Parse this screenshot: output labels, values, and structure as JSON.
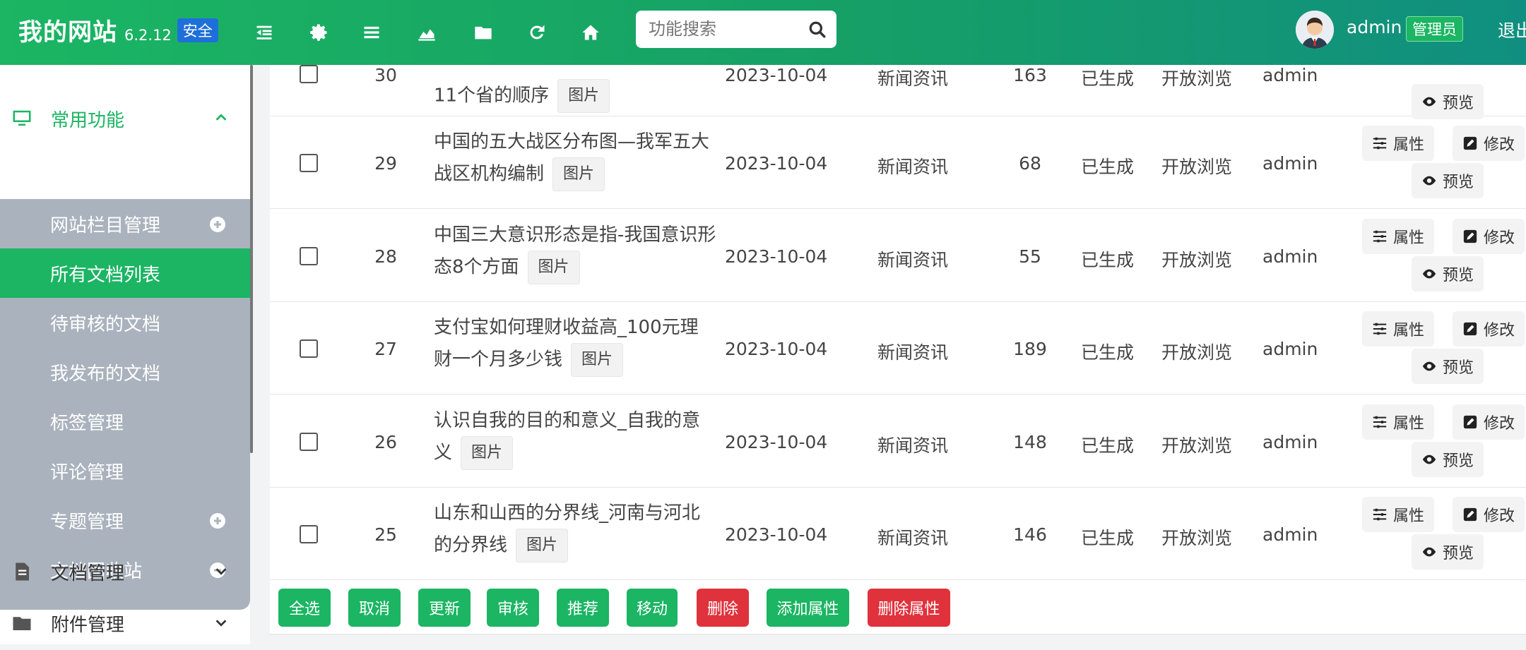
{
  "header": {
    "brand": "我的网站",
    "version": "6.2.12",
    "badge": "安全",
    "search_placeholder": "功能搜索",
    "user": "admin",
    "role": "管理员",
    "logout": "退出",
    "tools": [
      "outdent-icon",
      "gear-icon",
      "menu-icon",
      "chart-icon",
      "folder-icon",
      "refresh-icon",
      "home-icon"
    ]
  },
  "sidebar": {
    "group_common": "常用功能",
    "items": [
      {
        "label": "网站栏目管理",
        "icon": "plus-circle-icon"
      },
      {
        "label": "所有文档列表",
        "icon": ""
      },
      {
        "label": "待审核的文档",
        "icon": ""
      },
      {
        "label": "我发布的文档",
        "icon": ""
      },
      {
        "label": "标签管理",
        "icon": ""
      },
      {
        "label": "评论管理",
        "icon": ""
      },
      {
        "label": "专题管理",
        "icon": "plus-circle-icon"
      },
      {
        "label": "文档回收站",
        "icon": "minus-circle-icon"
      }
    ],
    "group_docs": "文档管理",
    "group_attach": "附件管理"
  },
  "rows": [
    {
      "id": "30",
      "title": "11个省的顺序",
      "tag": "图片",
      "date": "2023-10-04",
      "category": "新闻资讯",
      "clicks": "163",
      "status": "已生成",
      "access": "开放浏览",
      "author": "admin"
    },
    {
      "id": "29",
      "title": "中国的五大战区分布图—我军五大战区机构编制",
      "tag": "图片",
      "date": "2023-10-04",
      "category": "新闻资讯",
      "clicks": "68",
      "status": "已生成",
      "access": "开放浏览",
      "author": "admin"
    },
    {
      "id": "28",
      "title": "中国三大意识形态是指-我国意识形态8个方面",
      "tag": "图片",
      "date": "2023-10-04",
      "category": "新闻资讯",
      "clicks": "55",
      "status": "已生成",
      "access": "开放浏览",
      "author": "admin"
    },
    {
      "id": "27",
      "title": "支付宝如何理财收益高_100元理财一个月多少钱",
      "tag": "图片",
      "date": "2023-10-04",
      "category": "新闻资讯",
      "clicks": "189",
      "status": "已生成",
      "access": "开放浏览",
      "author": "admin"
    },
    {
      "id": "26",
      "title": "认识自我的目的和意义_自我的意义",
      "tag": "图片",
      "date": "2023-10-04",
      "category": "新闻资讯",
      "clicks": "148",
      "status": "已生成",
      "access": "开放浏览",
      "author": "admin"
    },
    {
      "id": "25",
      "title": "山东和山西的分界线_河南与河北的分界线",
      "tag": "图片",
      "date": "2023-10-04",
      "category": "新闻资讯",
      "clicks": "146",
      "status": "已生成",
      "access": "开放浏览",
      "author": "admin"
    }
  ],
  "actions": {
    "attr": "属性",
    "edit": "修改",
    "preview": "预览"
  },
  "bottom_buttons": [
    {
      "label": "全选",
      "style": "green"
    },
    {
      "label": "取消",
      "style": "green"
    },
    {
      "label": "更新",
      "style": "green"
    },
    {
      "label": "审核",
      "style": "green"
    },
    {
      "label": "推荐",
      "style": "green"
    },
    {
      "label": "移动",
      "style": "green"
    },
    {
      "label": "删除",
      "style": "red"
    },
    {
      "label": "添加属性",
      "style": "green"
    },
    {
      "label": "删除属性",
      "style": "red"
    }
  ],
  "colors": {
    "accent": "#1bb563",
    "danger": "#e0323c",
    "sidebar_sub": "#aab2bd",
    "badge_blue": "#1e6fd9"
  }
}
